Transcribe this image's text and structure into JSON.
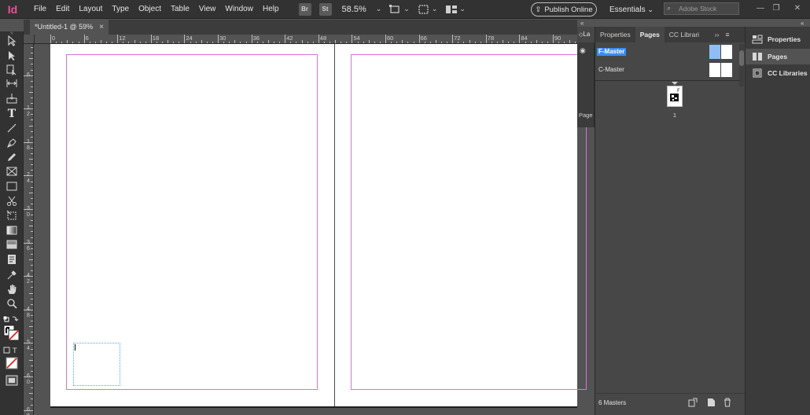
{
  "app": {
    "logo_text": "Id"
  },
  "menu": [
    "File",
    "Edit",
    "Layout",
    "Type",
    "Object",
    "Table",
    "View",
    "Window",
    "Help"
  ],
  "menubar": {
    "bridge_badge": "Br",
    "stock_badge": "St",
    "zoom": "58.5%",
    "publish_label": "Publish Online",
    "workspace_label": "Essentials",
    "stock_search_placeholder": "Adobe Stock"
  },
  "document_tab": {
    "title": "*Untitled-1 @ 59%",
    "close": "×"
  },
  "ruler_top_labels": [
    "0",
    "6",
    "12",
    "18",
    "24",
    "30",
    "36",
    "42",
    "48",
    "54",
    "60",
    "66",
    "72",
    "78",
    "84",
    "90"
  ],
  "ruler_left_labels": [
    "6",
    "1\n2",
    "1\n8",
    "2\n4",
    "3\n0",
    "3\n6",
    "4\n2",
    "4\n8",
    "5\n4",
    "6\n0",
    "6\n6"
  ],
  "collapsed_panel": {
    "tab_label": "La",
    "bottom_label": "Page"
  },
  "pages_panel": {
    "tabs": [
      "Properties",
      "Pages",
      "CC Librari"
    ],
    "active_tab": "Pages",
    "masters": [
      {
        "name": "F-Master",
        "selected": true
      },
      {
        "name": "C-Master",
        "selected": false
      }
    ],
    "page_number": "1",
    "footer_text": "6 Masters"
  },
  "right_dock": {
    "items": [
      {
        "label": "Properties",
        "active": false
      },
      {
        "label": "Pages",
        "active": true
      },
      {
        "label": "CC Libraries",
        "active": false
      }
    ]
  },
  "colors": {
    "accent": "#3d8bf0",
    "margin_guide": "#d873d8",
    "brand": "#e0569a"
  },
  "tools": [
    "selection-tool",
    "direct-selection-tool",
    "page-tool",
    "gap-tool",
    "content-collector-tool",
    "type-tool",
    "line-tool",
    "pen-tool",
    "pencil-tool",
    "rectangle-frame-tool",
    "rectangle-tool",
    "scissors-tool",
    "free-transform-tool",
    "gradient-swatch-tool",
    "gradient-feather-tool",
    "note-tool",
    "eyedropper-tool",
    "hand-tool",
    "zoom-tool"
  ]
}
